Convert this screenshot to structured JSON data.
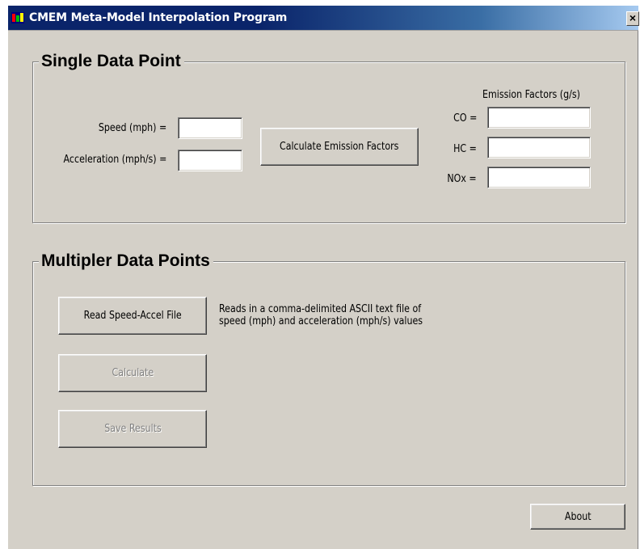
{
  "window": {
    "title": "CMEM Meta-Model Interpolation Program",
    "close_glyph": "×",
    "icon": "cmem-app-icon"
  },
  "single": {
    "title": "Single Data Point",
    "speed_label": "Speed (mph) =",
    "speed_value": "",
    "accel_label": "Acceleration (mph/s) =",
    "accel_value": "",
    "calc_button": "Calculate Emission Factors",
    "ef_header": "Emission Factors (g/s)",
    "co_label": "CO =",
    "co_value": "",
    "hc_label": "HC =",
    "hc_value": "",
    "nox_label": "NOx =",
    "nox_value": ""
  },
  "multi": {
    "title": "Multipler Data Points",
    "read_button": "Read Speed-Accel File",
    "read_desc_line1": "Reads in a comma-delimited ASCII text file of",
    "read_desc_line2": "speed (mph) and acceleration (mph/s) values",
    "calculate_button": "Calculate",
    "save_button": "Save Results"
  },
  "about_button": "About"
}
